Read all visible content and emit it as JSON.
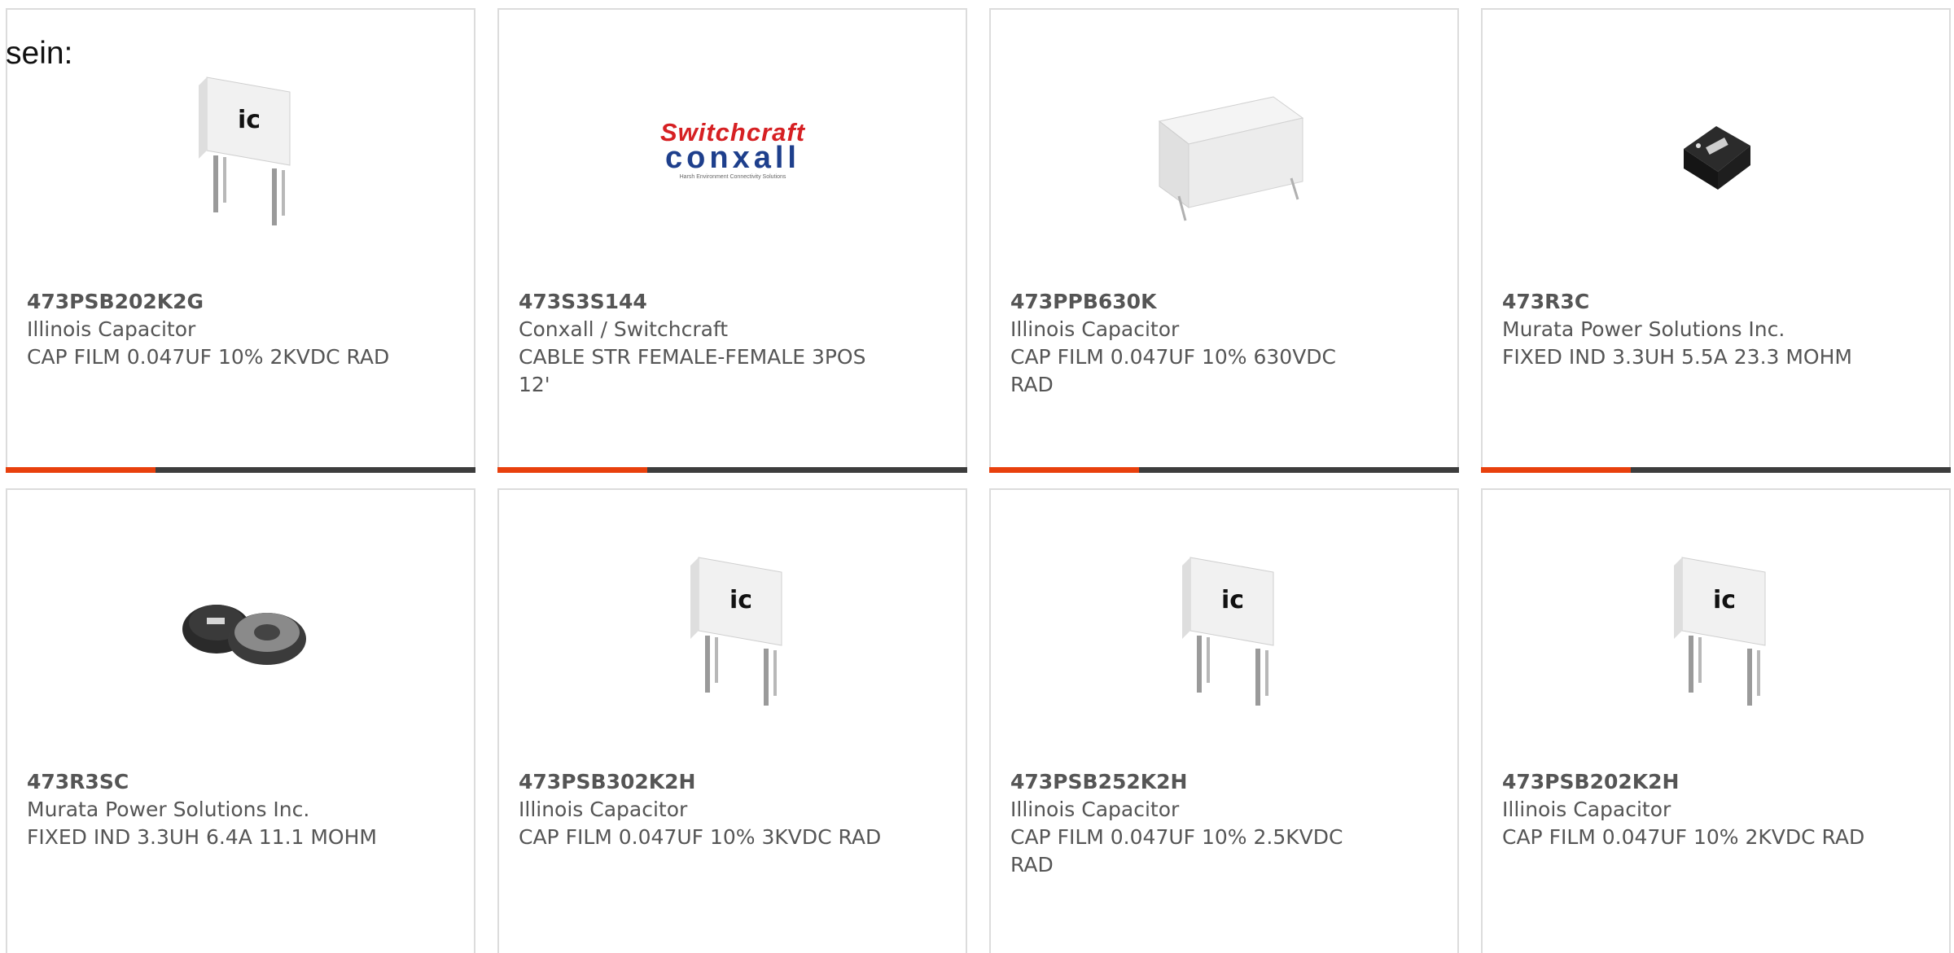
{
  "intro_text": "sein:",
  "colors": {
    "accent": "#e8400d",
    "bar": "#3d3d3d",
    "border": "#dcdcdc",
    "text": "#555555"
  },
  "products": [
    {
      "part": "473PSB202K2G",
      "maker": "Illinois Capacitor",
      "desc": "CAP FILM 0.047UF 10% 2KVDC RAD",
      "image": "film-capacitor-tall"
    },
    {
      "part": "473S3S144",
      "maker": "Conxall / Switchcraft",
      "desc": "CABLE STR FEMALE-FEMALE 3POS 12'",
      "image": "switchcraft-conxall-logo",
      "logo": {
        "line1": "Switchcraft",
        "line2": "conxall",
        "line3": "Harsh Environment Connectivity Solutions"
      }
    },
    {
      "part": "473PPB630K",
      "maker": "Illinois Capacitor",
      "desc": "CAP FILM 0.047UF 10% 630VDC RAD",
      "image": "film-capacitor-wide"
    },
    {
      "part": "473R3C",
      "maker": "Murata Power Solutions Inc.",
      "desc": "FIXED IND 3.3UH 5.5A 23.3 MOHM",
      "image": "smd-inductor"
    },
    {
      "part": "473R3SC",
      "maker": "Murata Power Solutions Inc.",
      "desc": "FIXED IND 3.3UH 6.4A 11.1 MOHM",
      "image": "smd-inductor-pair"
    },
    {
      "part": "473PSB302K2H",
      "maker": "Illinois Capacitor",
      "desc": "CAP FILM 0.047UF 10% 3KVDC RAD",
      "image": "film-capacitor-tall"
    },
    {
      "part": "473PSB252K2H",
      "maker": "Illinois Capacitor",
      "desc": "CAP FILM 0.047UF 10% 2.5KVDC RAD",
      "image": "film-capacitor-tall"
    },
    {
      "part": "473PSB202K2H",
      "maker": "Illinois Capacitor",
      "desc": "CAP FILM 0.047UF 10% 2KVDC RAD",
      "image": "film-capacitor-tall"
    }
  ]
}
